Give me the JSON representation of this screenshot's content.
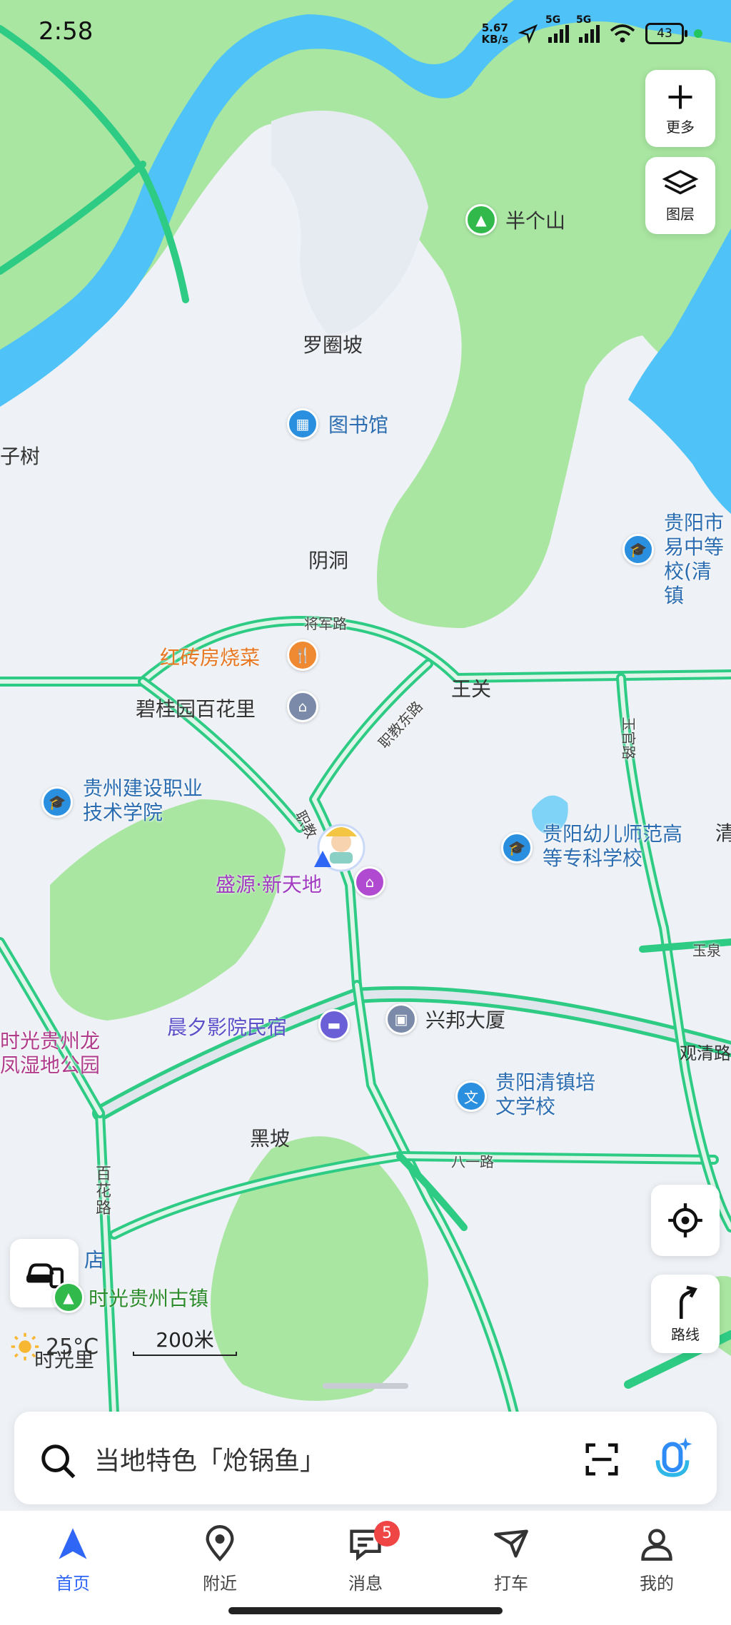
{
  "status_bar": {
    "time": "2:58",
    "net_speed_value": "5.67",
    "net_speed_unit": "KB/s",
    "signal_1": "5G",
    "signal_2": "5G",
    "battery": "43"
  },
  "map_controls": {
    "more_label": "更多",
    "layers_label": "图层",
    "route_label": "路线"
  },
  "place_labels": {
    "banshan": "半个山",
    "luoquanpo": "罗圈坡",
    "library": "图书馆",
    "zishu": "子树",
    "yindong": "阴洞",
    "hongzhuan": "红砖房烧菜",
    "wangguan": "王关",
    "biguiyuan": "碧桂园百花里",
    "jianshe": "贵州建设职业技术学院",
    "shengyuan": "盛源·新天地",
    "youer": "贵阳幼儿师范高等专科学校",
    "yizhong": "贵阳市易中等校(清镇",
    "chenxi": "晨夕影院民宿",
    "xingbang": "兴邦大厦",
    "peiwen": "贵阳清镇培文学校",
    "shiguang_park": "时光贵州龙凤湿地公园",
    "heipo": "黑坡",
    "guzhen": "时光贵州古镇",
    "shiguangli": "时光里",
    "dian": "店",
    "qing_edge": "清"
  },
  "road_labels": {
    "jiangjun": "将军路",
    "zhijiao_east": "职教东路",
    "zhijiao": "职教",
    "yuguan": "玉官路",
    "yuquan": "玉泉",
    "guanqing": "观清路",
    "bayi": "八一路",
    "baihua": "百花路"
  },
  "weather": {
    "temperature": "25°C"
  },
  "scale": {
    "label": "200米"
  },
  "search": {
    "placeholder": "当地特色「炝锅鱼」"
  },
  "nav": {
    "items": [
      {
        "label": "首页",
        "icon": "arrow-icon",
        "active": true
      },
      {
        "label": "附近",
        "icon": "location-pin-icon"
      },
      {
        "label": "消息",
        "icon": "message-icon",
        "badge": "5"
      },
      {
        "label": "打车",
        "icon": "taxi-icon"
      },
      {
        "label": "我的",
        "icon": "user-icon"
      }
    ]
  },
  "colors": {
    "water": "#4fc3f7",
    "green": "#a8e6a1",
    "road": "#2ecb84",
    "accent": "#2f66f6"
  }
}
